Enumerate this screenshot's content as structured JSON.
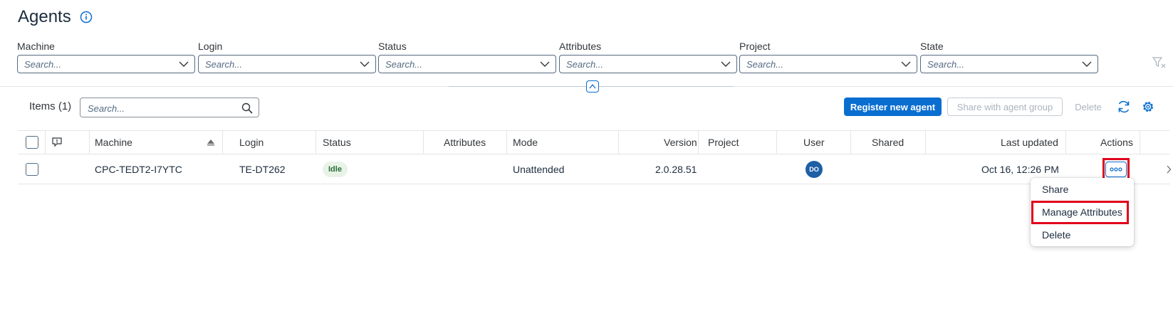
{
  "page": {
    "title": "Agents"
  },
  "filters": [
    {
      "label": "Machine",
      "placeholder": "Search..."
    },
    {
      "label": "Login",
      "placeholder": "Search..."
    },
    {
      "label": "Status",
      "placeholder": "Search..."
    },
    {
      "label": "Attributes",
      "placeholder": "Search..."
    },
    {
      "label": "Project",
      "placeholder": "Search..."
    },
    {
      "label": "State",
      "placeholder": "Search..."
    }
  ],
  "toolbar": {
    "items_label": "Items (1)",
    "search_placeholder": "Search...",
    "register_label": "Register new agent",
    "share_group_label": "Share with agent group",
    "delete_label": "Delete"
  },
  "table": {
    "columns": {
      "machine": "Machine",
      "login": "Login",
      "status": "Status",
      "attributes": "Attributes",
      "mode": "Mode",
      "version": "Version",
      "project": "Project",
      "user": "User",
      "shared": "Shared",
      "last_updated": "Last updated",
      "actions": "Actions"
    },
    "rows": [
      {
        "machine": "CPC-TEDT2-I7YTC",
        "login": "TE-DT262",
        "status": "Idle",
        "attributes": "",
        "mode": "Unattended",
        "version": "2.0.28.51",
        "project": "",
        "user_initials": "DO",
        "shared": "",
        "last_updated": "Oct 16, 12:26 PM"
      }
    ]
  },
  "actions_menu": {
    "items": [
      {
        "label": "Share"
      },
      {
        "label": "Manage Attributes"
      },
      {
        "label": "Delete"
      }
    ]
  },
  "colors": {
    "accent": "#0a6ed1",
    "highlight": "#e0001b",
    "status_idle_bg": "#e8f3e6",
    "status_idle_text": "#256f3a",
    "avatar": "#1e5fa5"
  }
}
